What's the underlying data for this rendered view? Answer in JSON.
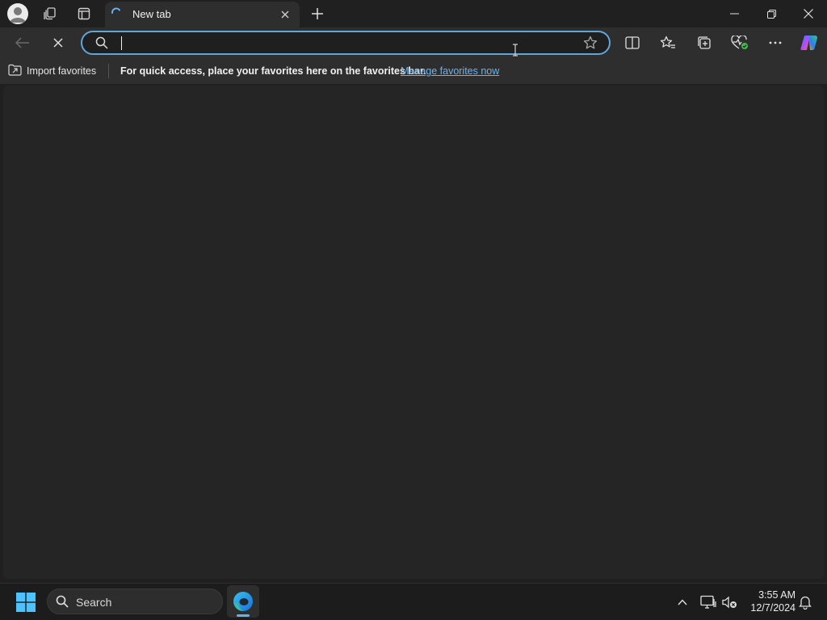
{
  "tab": {
    "title": "New tab"
  },
  "omnibox": {
    "value": "",
    "placeholder": ""
  },
  "favorites_bar": {
    "import_label": "Import favorites",
    "message": "For quick access, place your favorites here on the favorites bar.",
    "manage_link": "Manage favorites now"
  },
  "taskbar": {
    "search_label": "Search",
    "time": "3:55 AM",
    "date": "12/7/2024"
  },
  "colors": {
    "accent": "#60a7d8",
    "link": "#6cb4f0",
    "background": "#202020",
    "toolbar": "#2e2e2e"
  },
  "icons": {
    "tabstrip": [
      "profile-icon",
      "workspaces-icon",
      "vertical-tabs-icon",
      "loading-spinner-icon",
      "close-icon",
      "plus-icon",
      "minimize-icon",
      "restore-icon",
      "close-window-icon"
    ],
    "toolbar": [
      "back-arrow-icon",
      "stop-icon",
      "search-icon",
      "star-icon",
      "split-screen-icon",
      "favorites-icon",
      "collections-icon",
      "browser-essentials-icon",
      "more-icon",
      "copilot-icon"
    ],
    "taskbar": [
      "windows-logo-icon",
      "search-icon",
      "edge-icon",
      "chevron-up-icon",
      "network-icon",
      "volume-muted-icon",
      "notification-bell-icon"
    ]
  }
}
